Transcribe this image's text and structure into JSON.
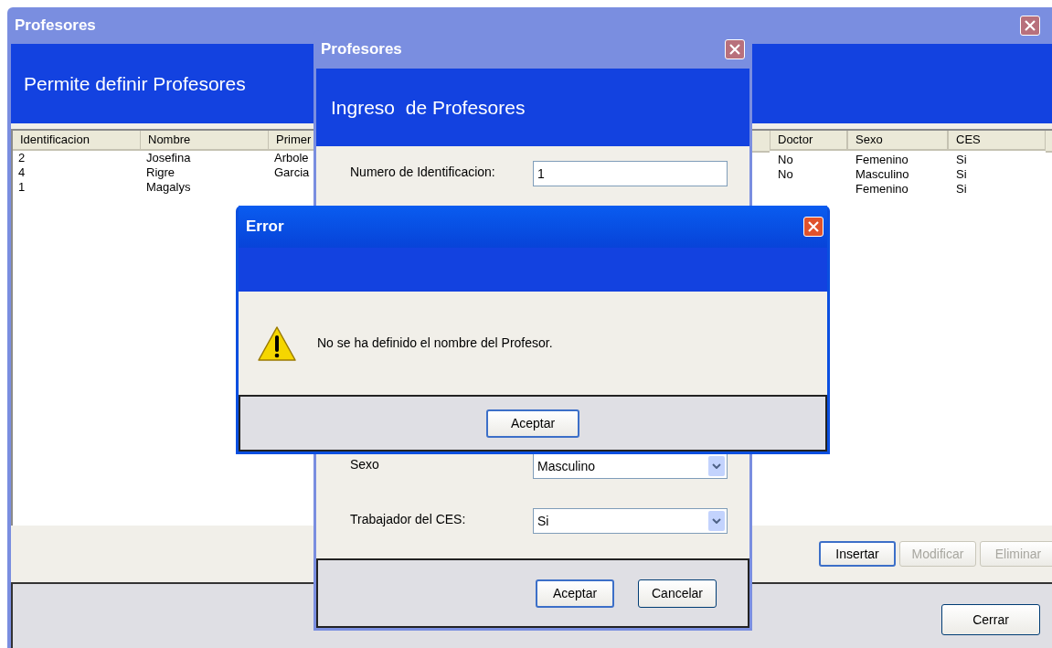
{
  "main_window": {
    "title": "Profesores",
    "header": "Permite definir Profesores",
    "table": {
      "columns_left": [
        "Identificacion",
        "Nombre",
        "Primer"
      ],
      "columns_right": [
        "Doctor",
        "Sexo",
        "CES"
      ],
      "rows": [
        {
          "column_1": "2",
          "column_2": "Josefina",
          "column_3": "Arbole",
          "column_4": "No",
          "column_5": "Femenino",
          "column_6": "Si"
        },
        {
          "column_1": "4",
          "column_2": "Rigre",
          "column_3": "Garcia",
          "column_4": "No",
          "column_5": "Masculino",
          "column_6": "Si"
        },
        {
          "column_1": "1",
          "column_2": "Magalys",
          "column_5": "Femenino",
          "column_6": "Si"
        }
      ]
    },
    "buttons": [
      {
        "label": "Insertar",
        "default": true,
        "disabled": false
      },
      {
        "label": "Modificar",
        "default": false,
        "disabled": true
      },
      {
        "label": "Eliminar",
        "default": false,
        "disabled": true
      }
    ],
    "close_button": "Cerrar"
  },
  "form_dialog": {
    "title": "Profesores",
    "header": "Ingreso  de Profesores",
    "fields": [
      {
        "kind": "text",
        "label": "Numero de Identificacion:",
        "value": "1"
      },
      {
        "kind": "select",
        "label": "Sexo",
        "value": "Masculino"
      },
      {
        "kind": "select",
        "label": "Trabajador del CES:",
        "value": "Si"
      }
    ],
    "buttons": [
      {
        "label": "Aceptar",
        "default": true
      },
      {
        "label": "Cancelar",
        "default": false
      }
    ]
  },
  "error_dialog": {
    "title": "Error",
    "message": "No se ha definido el nombre del Profesor.",
    "button": "Aceptar"
  }
}
